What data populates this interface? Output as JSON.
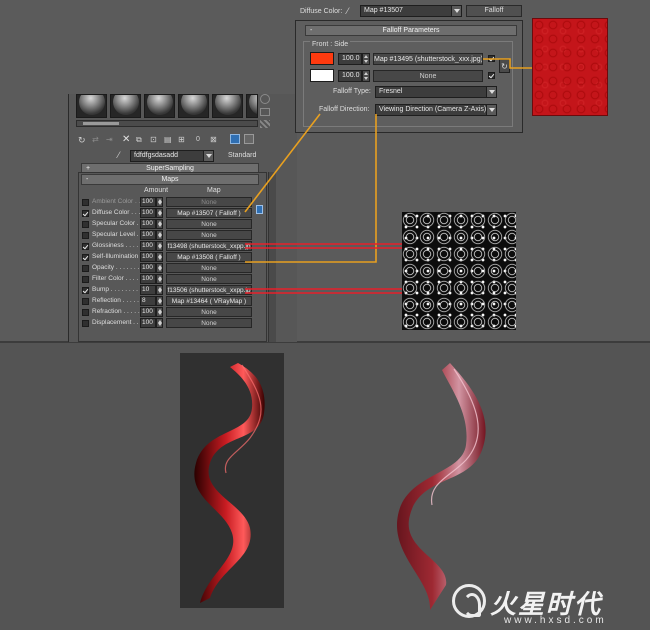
{
  "top_bar": {
    "diffuse_label": "Diffuse Color:",
    "map_name": "Map #13507",
    "map_type": "Falloff"
  },
  "falloff": {
    "rollout_title": "Falloff Parameters",
    "section_title": "Front : Side",
    "rows": [
      {
        "color": "#ff3a0f",
        "amount": "100.0",
        "map": "Map #13495 (shutterstock_xxx.jpg)",
        "checked": true
      },
      {
        "color": "#ffffff",
        "amount": "100.0",
        "map": "None",
        "checked": true
      }
    ],
    "type_label": "Falloff Type:",
    "type_value": "Fresnel",
    "direction_label": "Falloff Direction:",
    "direction_value": "Viewing Direction (Camera Z-Axis)"
  },
  "material": {
    "name": "fdfdfgsdasadd",
    "type": "Standard",
    "toolbar_value": "0"
  },
  "rollouts": {
    "supersampling": "SuperSampling",
    "maps": "Maps"
  },
  "maps_table": {
    "col_amount": "Amount",
    "col_map": "Map",
    "rows": [
      {
        "name": "Ambient Color . . .",
        "amount": "100",
        "map": "None",
        "checked": false,
        "dim": true
      },
      {
        "name": "Diffuse Color . . .",
        "amount": "100",
        "map": "Map #13507 ( Falloff )",
        "checked": true,
        "dim": false
      },
      {
        "name": "Specular Color . .",
        "amount": "100",
        "map": "None",
        "checked": false,
        "dim": false
      },
      {
        "name": "Specular Level . .",
        "amount": "100",
        "map": "None",
        "checked": false,
        "dim": false
      },
      {
        "name": "Glossiness . . . . .",
        "amount": "100",
        "map": "f13498 (shutterstock_xxpp.jp",
        "checked": true,
        "dim": false
      },
      {
        "name": "Self-Illumination .",
        "amount": "100",
        "map": "Map #13508 ( Falloff )",
        "checked": true,
        "dim": false
      },
      {
        "name": "Opacity . . . . . . .",
        "amount": "100",
        "map": "None",
        "checked": false,
        "dim": false
      },
      {
        "name": "Filter Color . . . .",
        "amount": "100",
        "map": "None",
        "checked": false,
        "dim": false
      },
      {
        "name": "Bump . . . . . . . .",
        "amount": "10",
        "map": "f13506 (shutterstock_xxpp.jp",
        "checked": true,
        "dim": false
      },
      {
        "name": "Reflection . . . . .",
        "amount": "8",
        "map": "Map #13464 ( VRayMap )",
        "checked": false,
        "dim": false
      },
      {
        "name": "Refraction . . . . .",
        "amount": "100",
        "map": "None",
        "checked": false,
        "dim": false
      },
      {
        "name": "Displacement . . .",
        "amount": "100",
        "map": "None",
        "checked": false,
        "dim": false
      }
    ]
  },
  "colors": {
    "red_texture": "#c4151a",
    "red_link": "#e8202a",
    "orange_link": "#e8a020"
  },
  "watermark": {
    "title": "火星时代",
    "url": "www.hxsd.com"
  }
}
